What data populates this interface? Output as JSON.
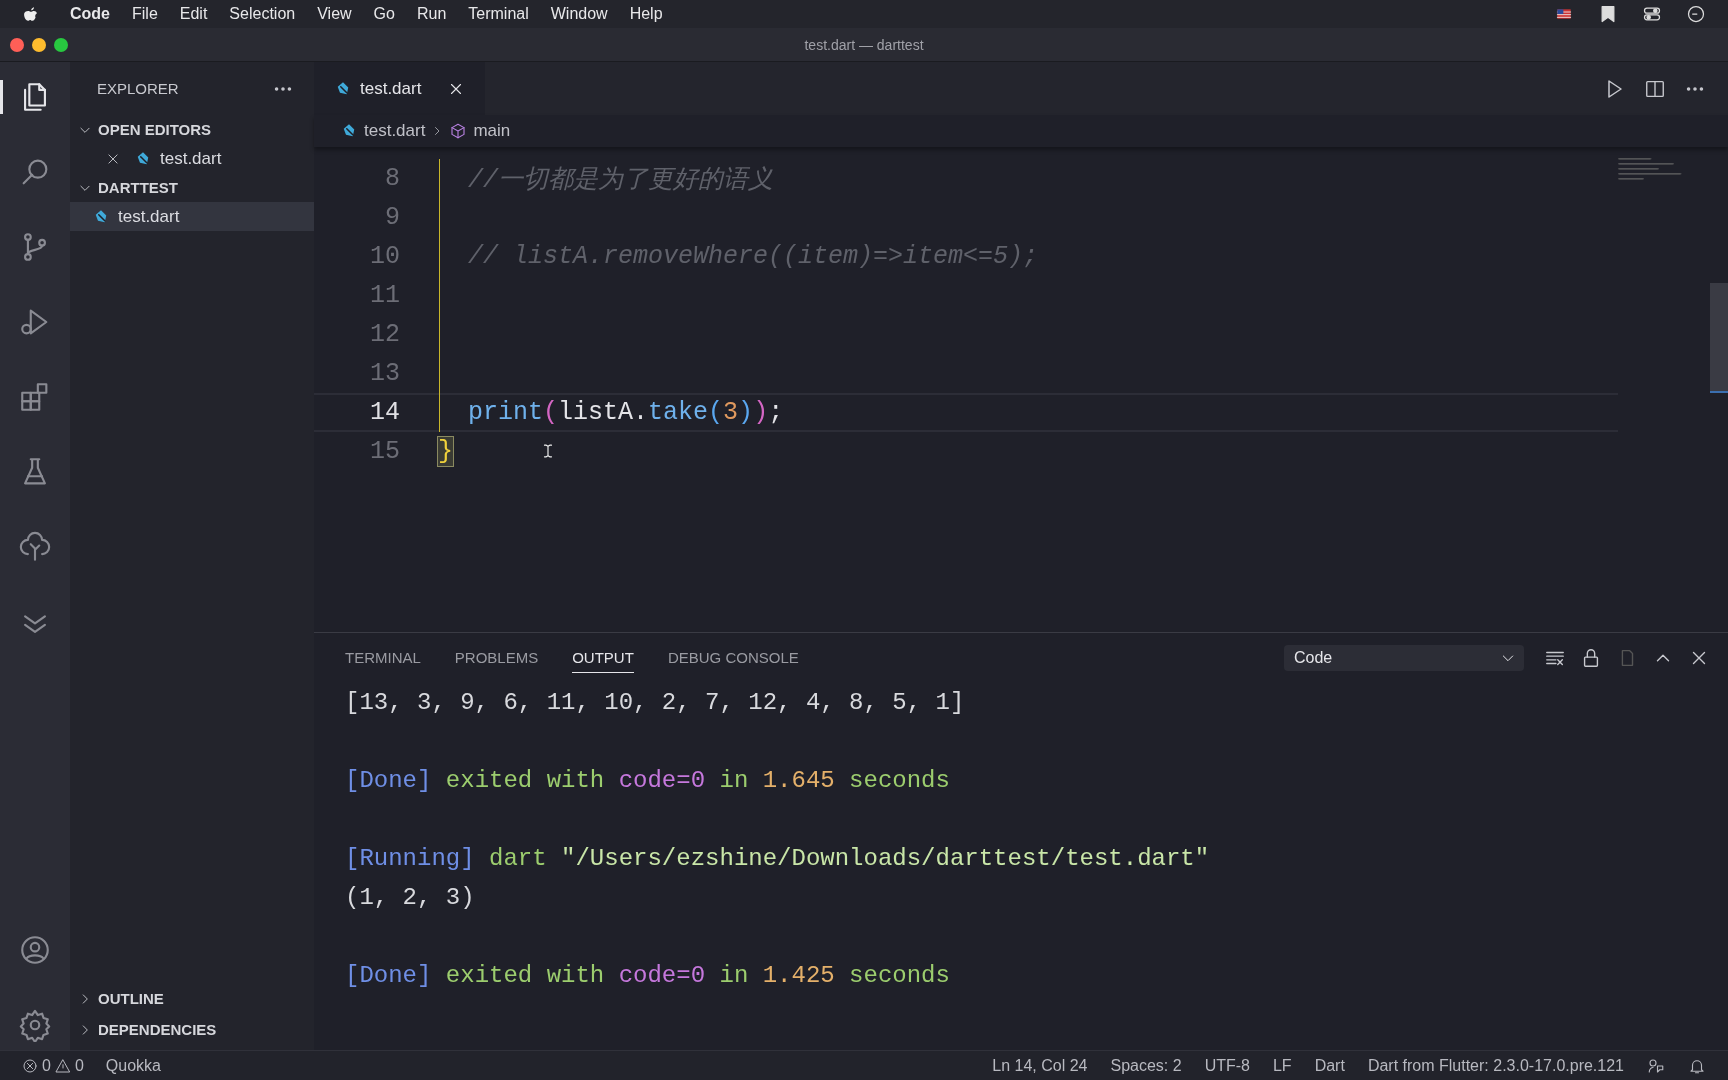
{
  "menu_bar": {
    "app": "Code",
    "items": [
      "File",
      "Edit",
      "Selection",
      "View",
      "Go",
      "Run",
      "Terminal",
      "Window",
      "Help"
    ]
  },
  "window": {
    "title": "test.dart — darttest"
  },
  "activity_bar": {
    "top": [
      {
        "kind": "files",
        "selected": true
      },
      {
        "kind": "search",
        "selected": false
      },
      {
        "kind": "source-control",
        "selected": false
      },
      {
        "kind": "run",
        "selected": false
      },
      {
        "kind": "extensions",
        "selected": false
      },
      {
        "kind": "testing",
        "selected": false
      },
      {
        "kind": "tree",
        "selected": false
      },
      {
        "kind": "chevrons",
        "selected": false
      }
    ],
    "bottom": [
      {
        "kind": "account",
        "selected": false
      },
      {
        "kind": "settings",
        "selected": false
      }
    ]
  },
  "sidebar": {
    "title": "EXPLORER",
    "sections": [
      {
        "title": "OPEN EDITORS",
        "expanded": true,
        "files": [
          {
            "name": "test.dart",
            "selected": false,
            "closable": true
          }
        ]
      },
      {
        "title": "DARTTEST",
        "expanded": true,
        "files": [
          {
            "name": "test.dart",
            "selected": true,
            "closable": false
          }
        ]
      }
    ],
    "bottom_sections": [
      {
        "title": "OUTLINE",
        "expanded": false
      },
      {
        "title": "DEPENDENCIES",
        "expanded": false
      }
    ]
  },
  "tabs": [
    {
      "label": "test.dart",
      "selected": true
    }
  ],
  "breadcrumbs": [
    {
      "label": "test.dart",
      "kind": "file"
    },
    {
      "label": "main",
      "kind": "symbol"
    }
  ],
  "editor": {
    "lines": [
      {
        "number": "8",
        "current": false,
        "tokens": [
          {
            "text": "  //一切都是为了更好的语义",
            "kind": "comment"
          }
        ]
      },
      {
        "number": "9",
        "current": false
      },
      {
        "number": "10",
        "current": false,
        "tokens": [
          {
            "text": "  // listA.removeWhere((item)=>item<=5);",
            "kind": "comment"
          }
        ]
      },
      {
        "number": "11",
        "current": false
      },
      {
        "number": "12",
        "current": false
      },
      {
        "number": "13",
        "current": false
      },
      {
        "number": "14",
        "current": true,
        "tokens": [
          {
            "text": "  print",
            "kind": "fn"
          },
          {
            "text": "(",
            "kind": "bracket1"
          },
          {
            "text": "listA.",
            "kind": "plain"
          },
          {
            "text": "take",
            "kind": "fn"
          },
          {
            "text": "(",
            "kind": "bracket2"
          },
          {
            "text": "3",
            "kind": "num"
          },
          {
            "text": ")",
            "kind": "bracket2"
          },
          {
            "text": ")",
            "kind": "bracket1"
          },
          {
            "text": ";",
            "kind": "plain"
          }
        ]
      },
      {
        "number": "15",
        "current": false,
        "tokens": [
          {
            "text": "}",
            "kind": "brace-match"
          }
        ]
      }
    ]
  },
  "panel": {
    "tabs": [
      {
        "label": "TERMINAL",
        "selected": false
      },
      {
        "label": "PROBLEMS",
        "selected": false
      },
      {
        "label": "OUTPUT",
        "selected": true
      },
      {
        "label": "DEBUG CONSOLE",
        "selected": false
      }
    ],
    "channel": "Code",
    "lines": [
      {
        "kind": "text",
        "tokens": [
          {
            "text": "[13, 3, 9, 6, 11, 10, 2, 7, 12, 4, 8, 5, 1]",
            "kind": "plain"
          }
        ]
      },
      {
        "kind": "blank"
      },
      {
        "kind": "text",
        "tokens": [
          {
            "text": "[Done]",
            "kind": "tag"
          },
          {
            "text": " exited with ",
            "kind": "green"
          },
          {
            "text": "code=0",
            "kind": "purple"
          },
          {
            "text": " in ",
            "kind": "green"
          },
          {
            "text": "1.645",
            "kind": "orange"
          },
          {
            "text": " seconds",
            "kind": "green"
          }
        ]
      },
      {
        "kind": "blank"
      },
      {
        "kind": "text",
        "tokens": [
          {
            "text": "[Running]",
            "kind": "tag"
          },
          {
            "text": " dart ",
            "kind": "green"
          },
          {
            "text": "\"/Users/ezshine/Downloads/darttest/test.dart\"",
            "kind": "string"
          }
        ]
      },
      {
        "kind": "text",
        "tokens": [
          {
            "text": "(1, 2, 3)",
            "kind": "plain"
          }
        ]
      },
      {
        "kind": "blank"
      },
      {
        "kind": "text",
        "tokens": [
          {
            "text": "[Done]",
            "kind": "tag"
          },
          {
            "text": " exited with ",
            "kind": "green"
          },
          {
            "text": "code=0",
            "kind": "purple"
          },
          {
            "text": " in ",
            "kind": "green"
          },
          {
            "text": "1.425",
            "kind": "orange"
          },
          {
            "text": " seconds",
            "kind": "green"
          }
        ]
      }
    ]
  },
  "status_bar": {
    "errors": "0",
    "warnings": "0",
    "left": [
      "Quokka"
    ],
    "right": [
      "Ln 14, Col 24",
      "Spaces: 2",
      "UTF-8",
      "LF",
      "Dart",
      "Dart from Flutter: 2.3.0-17.0.pre.121"
    ]
  }
}
